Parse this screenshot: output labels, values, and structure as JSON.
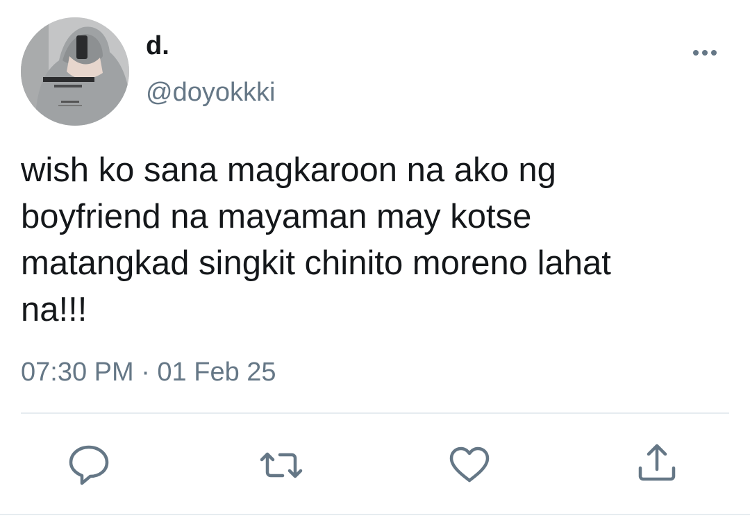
{
  "author": {
    "display_name": "d.",
    "handle": "@doyokkki"
  },
  "tweet": {
    "text_lines": [
      "wish ko sana magkaroon na ako ng",
      "boyfriend na mayaman may kotse",
      "matangkad singkit chinito moreno lahat",
      "na!!!"
    ],
    "timestamp": "07:30 PM · 01 Feb 25"
  },
  "actions": [
    {
      "icon": "reply-icon"
    },
    {
      "icon": "retweet-icon"
    },
    {
      "icon": "like-icon"
    },
    {
      "icon": "share-icon"
    }
  ],
  "colors": {
    "text_primary": "#14171a",
    "text_secondary": "#657786",
    "icon": "#657786",
    "divider": "#e6ecf0"
  }
}
